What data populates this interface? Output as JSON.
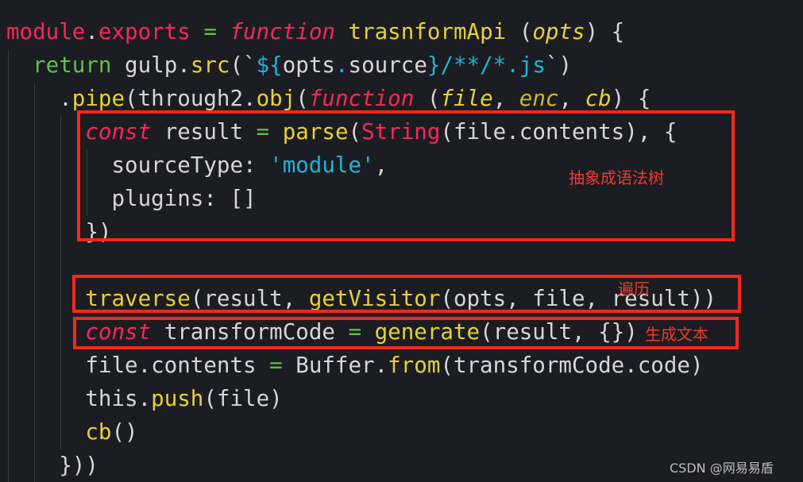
{
  "editor": {
    "indent_spaces": 2,
    "lines": [
      {
        "indent": 0,
        "tokens": [
          [
            "module",
            "p"
          ],
          [
            ".",
            "w"
          ],
          [
            "exports",
            "p"
          ],
          [
            " ",
            "w"
          ],
          [
            "=",
            "g"
          ],
          [
            " ",
            "w"
          ],
          [
            "function",
            "p i"
          ],
          [
            " ",
            "w"
          ],
          [
            "trasnformApi",
            "y"
          ],
          [
            " (",
            "w"
          ],
          [
            "opts",
            "y i"
          ],
          [
            ") {",
            "w"
          ]
        ]
      },
      {
        "indent": 1,
        "tokens": [
          [
            "return",
            "g"
          ],
          [
            " gulp.",
            "w"
          ],
          [
            "src",
            "y"
          ],
          [
            "(`",
            "w"
          ],
          [
            "${",
            "c"
          ],
          [
            "opts",
            "w"
          ],
          [
            ".",
            "c"
          ],
          [
            "source",
            "w"
          ],
          [
            "}",
            "c"
          ],
          [
            "/**/*.js",
            "c"
          ],
          [
            "`)",
            "w"
          ]
        ]
      },
      {
        "indent": 2,
        "tokens": [
          [
            ".",
            "w"
          ],
          [
            "pipe",
            "y"
          ],
          [
            "(through2.",
            "w"
          ],
          [
            "obj",
            "y"
          ],
          [
            "(",
            "w"
          ],
          [
            "function",
            "p i"
          ],
          [
            " (",
            "w"
          ],
          [
            "file",
            "y i"
          ],
          [
            ", ",
            "w"
          ],
          [
            "enc",
            "o i"
          ],
          [
            ", ",
            "w"
          ],
          [
            "cb",
            "y i"
          ],
          [
            ") {",
            "w"
          ]
        ]
      },
      {
        "indent": 3,
        "tokens": [
          [
            "const",
            "p i"
          ],
          [
            " result ",
            "w"
          ],
          [
            "=",
            "g"
          ],
          [
            " ",
            "w"
          ],
          [
            "parse",
            "y"
          ],
          [
            "(",
            "w"
          ],
          [
            "String",
            "p"
          ],
          [
            "(file.contents), {",
            "w"
          ]
        ]
      },
      {
        "indent": 4,
        "tokens": [
          [
            "sourceType: ",
            "w"
          ],
          [
            "'module'",
            "c"
          ],
          [
            ",",
            "w"
          ]
        ]
      },
      {
        "indent": 4,
        "tokens": [
          [
            "plugins: []",
            "w"
          ]
        ]
      },
      {
        "indent": 3,
        "tokens": [
          [
            "})",
            "w"
          ]
        ]
      },
      {
        "indent": 0,
        "tokens": []
      },
      {
        "indent": 3,
        "tokens": [
          [
            "traverse",
            "y"
          ],
          [
            "(result, ",
            "w"
          ],
          [
            "getVisitor",
            "y"
          ],
          [
            "(opts, file, result))",
            "w"
          ]
        ]
      },
      {
        "indent": 3,
        "tokens": [
          [
            "const",
            "p i"
          ],
          [
            " transformCode ",
            "w"
          ],
          [
            "=",
            "g"
          ],
          [
            " ",
            "w"
          ],
          [
            "generate",
            "y"
          ],
          [
            "(result, {})",
            "w"
          ]
        ]
      },
      {
        "indent": 3,
        "tokens": [
          [
            "file.contents ",
            "w"
          ],
          [
            "=",
            "g"
          ],
          [
            " Buffer.",
            "w"
          ],
          [
            "from",
            "y"
          ],
          [
            "(transformCode.code)",
            "w"
          ]
        ]
      },
      {
        "indent": 3,
        "tokens": [
          [
            "this.",
            "w"
          ],
          [
            "push",
            "y"
          ],
          [
            "(file)",
            "w"
          ]
        ]
      },
      {
        "indent": 3,
        "tokens": [
          [
            "cb",
            "y"
          ],
          [
            "()",
            "w"
          ]
        ]
      },
      {
        "indent": 2,
        "tokens": [
          [
            "}))",
            "w"
          ]
        ]
      }
    ]
  },
  "annotations": {
    "ast": "抽象成语法树",
    "traverse": "遍历",
    "generate": "生成文本"
  },
  "watermark": "CSDN @网易易盾",
  "colors": {
    "background": "#1c1d22",
    "annotation": "#f6271c"
  }
}
